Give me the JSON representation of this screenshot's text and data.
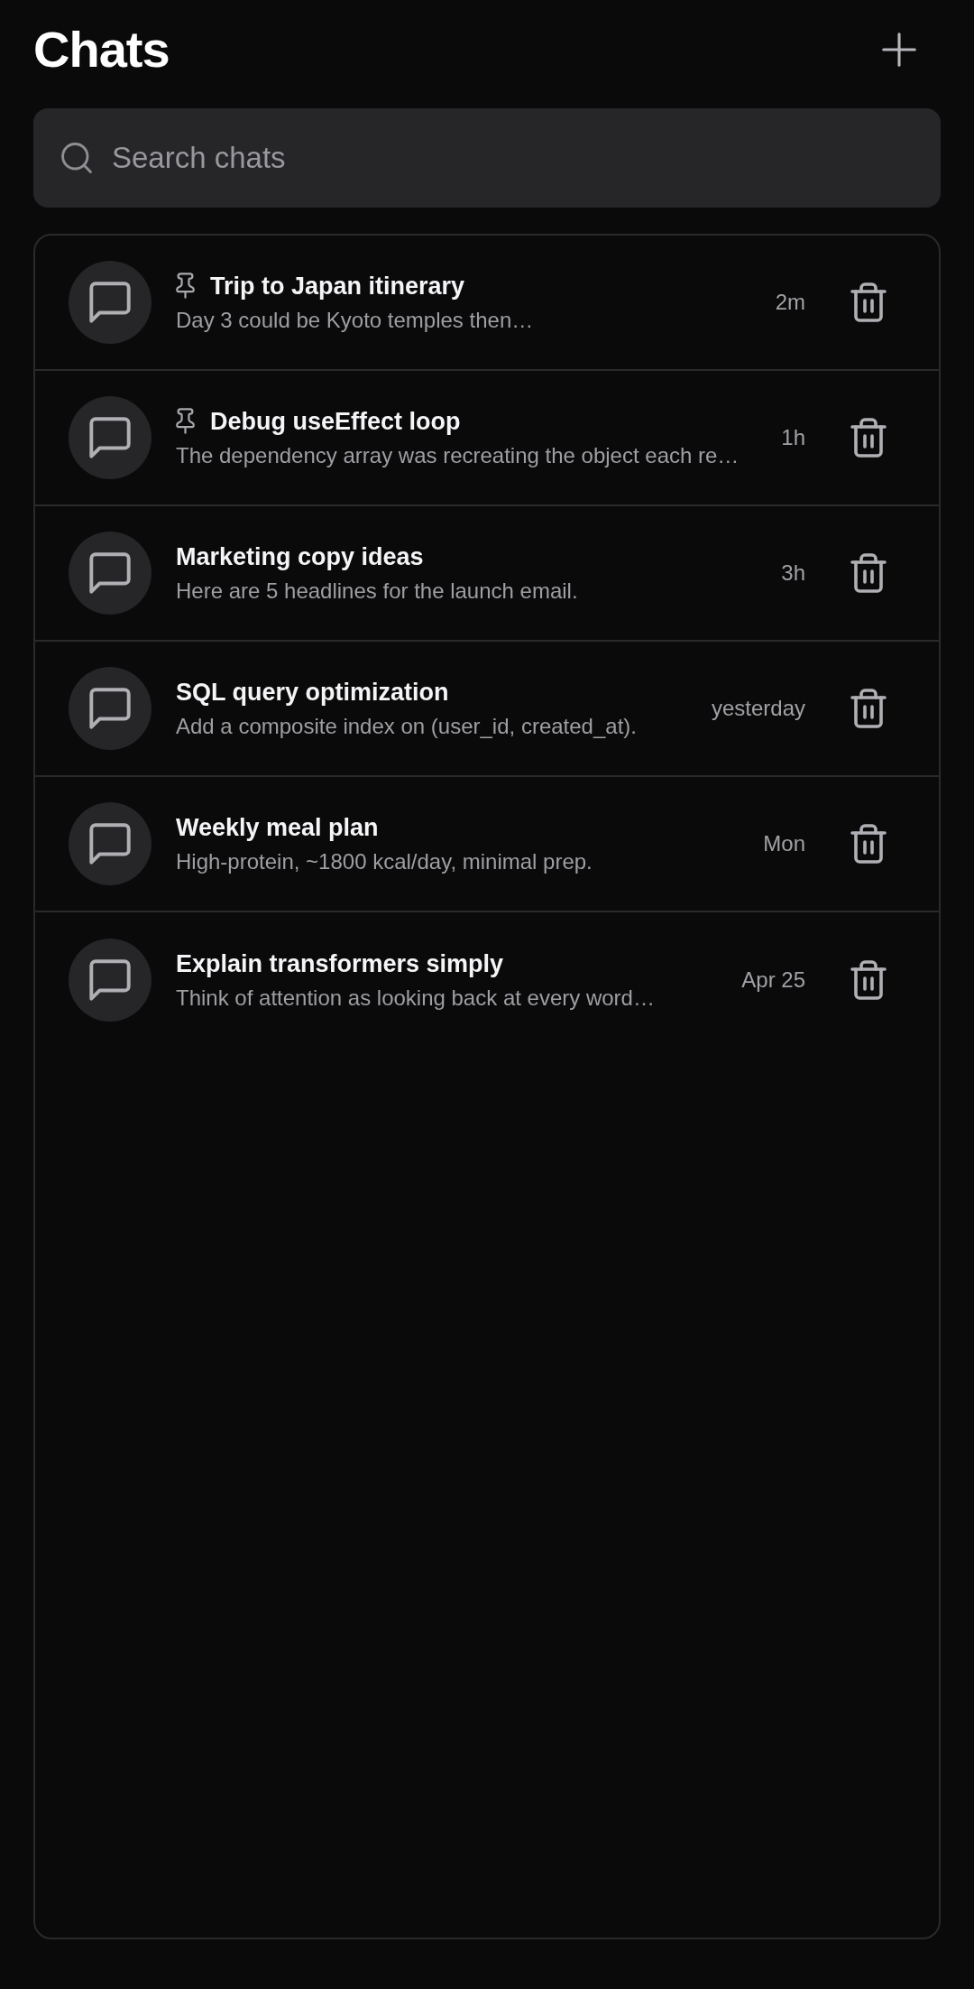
{
  "header": {
    "title": "Chats"
  },
  "search": {
    "placeholder": "Search chats"
  },
  "chats": [
    {
      "title": "Trip to Japan itinerary",
      "pinned": true,
      "preview": "Day 3 could be Kyoto temples then…",
      "time": "2m"
    },
    {
      "title": "Debug useEffect loop",
      "pinned": true,
      "preview": "The dependency array was recreating the object each re…",
      "time": "1h"
    },
    {
      "title": "Marketing copy ideas",
      "pinned": false,
      "preview": "Here are 5 headlines for the launch email.",
      "time": "3h"
    },
    {
      "title": "SQL query optimization",
      "pinned": false,
      "preview": "Add a composite index on (user_id, created_at).",
      "time": "yesterday"
    },
    {
      "title": "Weekly meal plan",
      "pinned": false,
      "preview": "High-protein, ~1800 kcal/day, minimal prep.",
      "time": "Mon"
    },
    {
      "title": "Explain transformers simply",
      "pinned": false,
      "preview": "Think of attention as looking back at every word…",
      "time": "Apr 25"
    }
  ]
}
